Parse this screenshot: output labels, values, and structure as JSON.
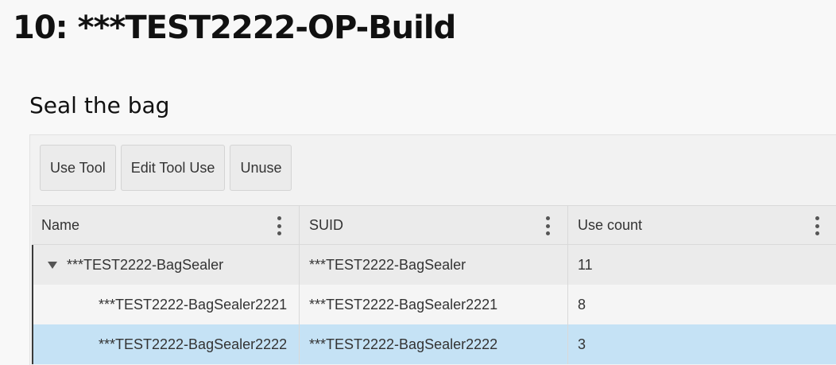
{
  "page": {
    "title": "10: ***TEST2222-OP-Build"
  },
  "section": {
    "title": "Seal the bag"
  },
  "toolbar": {
    "use_tool_label": "Use Tool",
    "edit_tool_use_label": "Edit Tool Use",
    "unuse_label": "Unuse"
  },
  "grid": {
    "columns": {
      "name": "Name",
      "suid": "SUID",
      "use_count": "Use count"
    },
    "rows": [
      {
        "name": "***TEST2222-BagSealer",
        "suid": "***TEST2222-BagSealer",
        "use_count": "11",
        "expanded": true,
        "level": 0
      },
      {
        "name": "***TEST2222-BagSealer2221",
        "suid": "***TEST2222-BagSealer2221",
        "use_count": "8",
        "level": 1
      },
      {
        "name": "***TEST2222-BagSealer2222",
        "suid": "***TEST2222-BagSealer2222",
        "use_count": "3",
        "level": 1,
        "selected": true
      }
    ]
  },
  "icons": {
    "column_menu": "more-vertical-icon",
    "tree_toggle": "triangle-down-icon"
  },
  "colors": {
    "selected_row": "#c5e2f5",
    "background": "#f8f8f8"
  }
}
